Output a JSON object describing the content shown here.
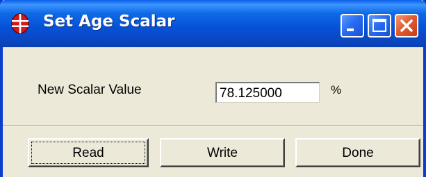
{
  "window": {
    "title": "Set Age Scalar"
  },
  "title_bar": {
    "icon": "app-icon",
    "controls": [
      "minimize-icon",
      "maximize-icon",
      "close-icon"
    ]
  },
  "form": {
    "label": "New Scalar Value",
    "value": "78.125000",
    "unit": "%"
  },
  "buttons": {
    "read": "Read",
    "write": "Write",
    "done": "Done"
  },
  "colors": {
    "titlebar": "#0651d8",
    "dialog_bg": "#ece9d8",
    "close_button": "#e25c30",
    "app_icon": "#d81818"
  }
}
